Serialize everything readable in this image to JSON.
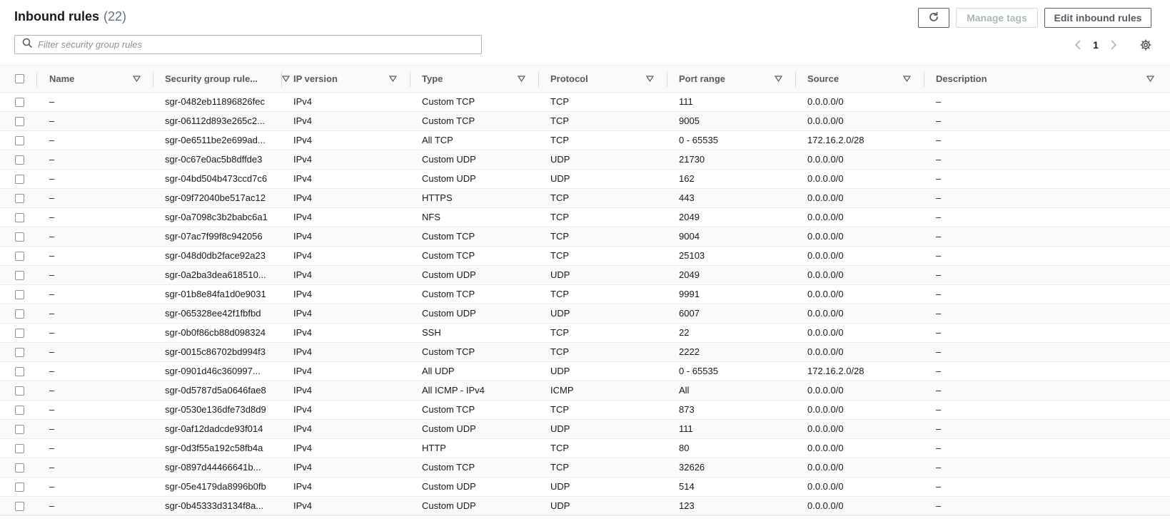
{
  "header": {
    "title": "Inbound rules",
    "count": "(22)"
  },
  "buttons": {
    "manage_tags": "Manage tags",
    "edit_inbound": "Edit inbound rules"
  },
  "search": {
    "placeholder": "Filter security group rules",
    "value": ""
  },
  "pagination": {
    "current_page": "1"
  },
  "columns": [
    "Name",
    "Security group rule...",
    "IP version",
    "Type",
    "Protocol",
    "Port range",
    "Source",
    "Description"
  ],
  "rows": [
    [
      "–",
      "sgr-0482eb11896826fec",
      "IPv4",
      "Custom TCP",
      "TCP",
      "111",
      "0.0.0.0/0",
      "–"
    ],
    [
      "–",
      "sgr-06112d893e265c2...",
      "IPv4",
      "Custom TCP",
      "TCP",
      "9005",
      "0.0.0.0/0",
      "–"
    ],
    [
      "–",
      "sgr-0e6511be2e699ad...",
      "IPv4",
      "All TCP",
      "TCP",
      "0 - 65535",
      "172.16.2.0/28",
      "–"
    ],
    [
      "–",
      "sgr-0c67e0ac5b8dffde3",
      "IPv4",
      "Custom UDP",
      "UDP",
      "21730",
      "0.0.0.0/0",
      "–"
    ],
    [
      "–",
      "sgr-04bd504b473ccd7c6",
      "IPv4",
      "Custom UDP",
      "UDP",
      "162",
      "0.0.0.0/0",
      "–"
    ],
    [
      "–",
      "sgr-09f72040be517ac12",
      "IPv4",
      "HTTPS",
      "TCP",
      "443",
      "0.0.0.0/0",
      "–"
    ],
    [
      "–",
      "sgr-0a7098c3b2babc6a1",
      "IPv4",
      "NFS",
      "TCP",
      "2049",
      "0.0.0.0/0",
      "–"
    ],
    [
      "–",
      "sgr-07ac7f99f8c942056",
      "IPv4",
      "Custom TCP",
      "TCP",
      "9004",
      "0.0.0.0/0",
      "–"
    ],
    [
      "–",
      "sgr-048d0db2face92a23",
      "IPv4",
      "Custom TCP",
      "TCP",
      "25103",
      "0.0.0.0/0",
      "–"
    ],
    [
      "–",
      "sgr-0a2ba3dea618510...",
      "IPv4",
      "Custom UDP",
      "UDP",
      "2049",
      "0.0.0.0/0",
      "–"
    ],
    [
      "–",
      "sgr-01b8e84fa1d0e9031",
      "IPv4",
      "Custom TCP",
      "TCP",
      "9991",
      "0.0.0.0/0",
      "–"
    ],
    [
      "–",
      "sgr-065328ee42f1fbfbd",
      "IPv4",
      "Custom UDP",
      "UDP",
      "6007",
      "0.0.0.0/0",
      "–"
    ],
    [
      "–",
      "sgr-0b0f86cb88d098324",
      "IPv4",
      "SSH",
      "TCP",
      "22",
      "0.0.0.0/0",
      "–"
    ],
    [
      "–",
      "sgr-0015c86702bd994f3",
      "IPv4",
      "Custom TCP",
      "TCP",
      "2222",
      "0.0.0.0/0",
      "–"
    ],
    [
      "–",
      "sgr-0901d46c360997...",
      "IPv4",
      "All UDP",
      "UDP",
      "0 - 65535",
      "172.16.2.0/28",
      "–"
    ],
    [
      "–",
      "sgr-0d5787d5a0646fae8",
      "IPv4",
      "All ICMP - IPv4",
      "ICMP",
      "All",
      "0.0.0.0/0",
      "–"
    ],
    [
      "–",
      "sgr-0530e136dfe73d8d9",
      "IPv4",
      "Custom TCP",
      "TCP",
      "873",
      "0.0.0.0/0",
      "–"
    ],
    [
      "–",
      "sgr-0af12dadcde93f014",
      "IPv4",
      "Custom UDP",
      "UDP",
      "111",
      "0.0.0.0/0",
      "–"
    ],
    [
      "–",
      "sgr-0d3f55a192c58fb4a",
      "IPv4",
      "HTTP",
      "TCP",
      "80",
      "0.0.0.0/0",
      "–"
    ],
    [
      "–",
      "sgr-0897d44466641b...",
      "IPv4",
      "Custom TCP",
      "TCP",
      "32626",
      "0.0.0.0/0",
      "–"
    ],
    [
      "–",
      "sgr-05e4179da8996b0fb",
      "IPv4",
      "Custom UDP",
      "UDP",
      "514",
      "0.0.0.0/0",
      "–"
    ],
    [
      "–",
      "sgr-0b45333d3134f8a...",
      "IPv4",
      "Custom UDP",
      "UDP",
      "123",
      "0.0.0.0/0",
      "–"
    ]
  ],
  "icons": {
    "refresh": "refresh-icon",
    "search": "search-icon",
    "prev": "chevron-left-icon",
    "next": "chevron-right-icon",
    "settings": "gear-icon",
    "sort": "sort-down-icon"
  },
  "colors": {
    "text": "#16191f",
    "muted": "#687078",
    "border": "#eaeded",
    "disabled": "#aab7b8"
  }
}
